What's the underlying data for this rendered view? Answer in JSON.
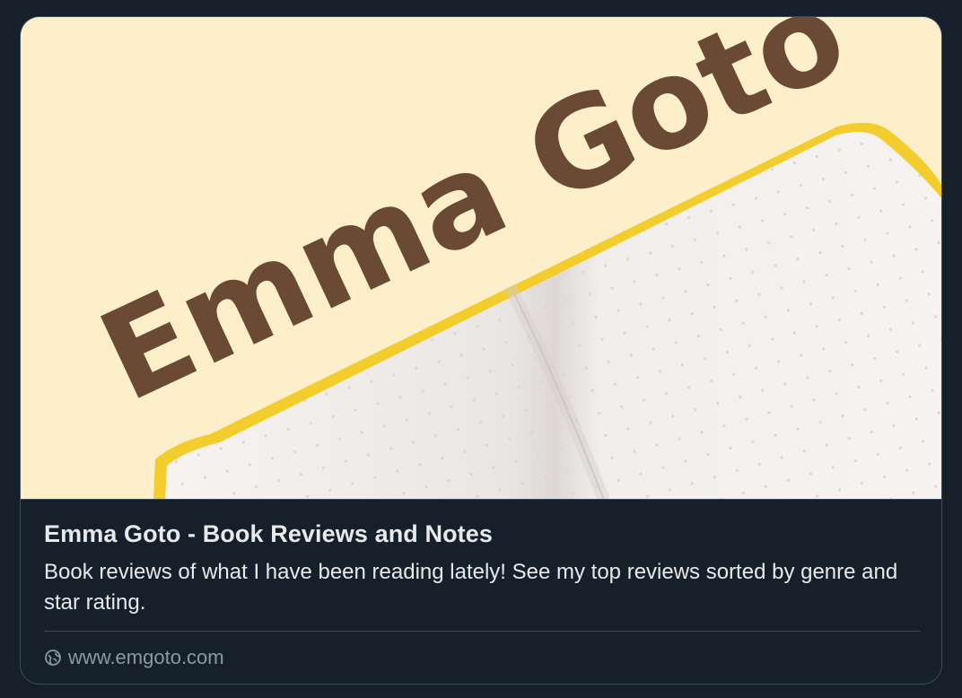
{
  "hero": {
    "wordmark": "Emma Goto",
    "background_color": "#fcefc9",
    "wordmark_color": "#6b4a35",
    "notebook_edge_color": "#f3cd2c"
  },
  "card": {
    "title": "Emma Goto - Book Reviews and Notes",
    "description": "Book reviews of what I have been reading lately! See my top reviews sorted by genre and star rating.",
    "domain_icon": "globe-icon",
    "domain": "www.emgoto.com"
  },
  "colors": {
    "page_background": "#15202b",
    "border": "#3d4a57",
    "primary_text": "#e7e9ea",
    "secondary_text": "#8b98a5"
  }
}
